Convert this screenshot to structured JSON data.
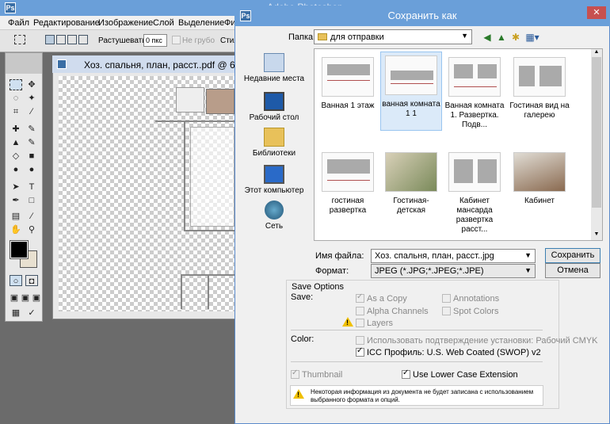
{
  "ps": {
    "title": "Adobe Photoshop",
    "menu": [
      "Файл",
      "Редактирование",
      "Изображение",
      "Слой",
      "Выделение",
      "Фи"
    ],
    "options": {
      "feather_label": "Растушевать:",
      "feather_value": "0 пкс",
      "antialias_label": "Не грубо",
      "style_label": "Стил"
    }
  },
  "doc": {
    "title": "Хоз. спальня, план, расст..pdf @ 66"
  },
  "dialog": {
    "title": "Сохранить как",
    "close": "✕",
    "folder_label": "Папка:",
    "folder_value": "для отправки",
    "places": [
      "Недавние места",
      "Рабочий стол",
      "Библиотеки",
      "Этот компьютер",
      "Сеть"
    ],
    "files": [
      {
        "label": "Ванная 1 этаж",
        "selected": false
      },
      {
        "label": "ванная комната 1 1",
        "selected": true
      },
      {
        "label": "Ванная комната 1. Развертка. Подв...",
        "selected": false
      },
      {
        "label": "Гостиная вид на галерею",
        "selected": false
      },
      {
        "label": "гостиная развертка",
        "selected": false
      },
      {
        "label": "Гостиная-детская",
        "selected": false
      },
      {
        "label": "Кабинет мансарда развертка расст...",
        "selected": false
      },
      {
        "label": "Кабинет",
        "selected": false
      }
    ],
    "filename_label": "Имя файла:",
    "filename_value": "Хоз. спальня, план, расст..jpg",
    "format_label": "Формат:",
    "format_value": "JPEG (*.JPG;*.JPEG;*.JPE)",
    "save_btn": "Сохранить",
    "cancel_btn": "Отмена",
    "save_options": {
      "header": "Save Options",
      "save_label": "Save:",
      "as_copy": "As a Copy",
      "alpha": "Alpha Channels",
      "layers": "Layers",
      "annotations": "Annotations",
      "spot": "Spot Colors",
      "color_label": "Color:",
      "proof": "Использовать подтверждение установки:  Рабочий CMYK",
      "icc": "ICC Профиль:  U.S. Web Coated (SWOP) v2",
      "thumbnail": "Thumbnail",
      "lowercase": "Use Lower Case Extension",
      "note": "Некоторая информация из документа не будет записана с использованием выбранного формата и опций."
    }
  }
}
